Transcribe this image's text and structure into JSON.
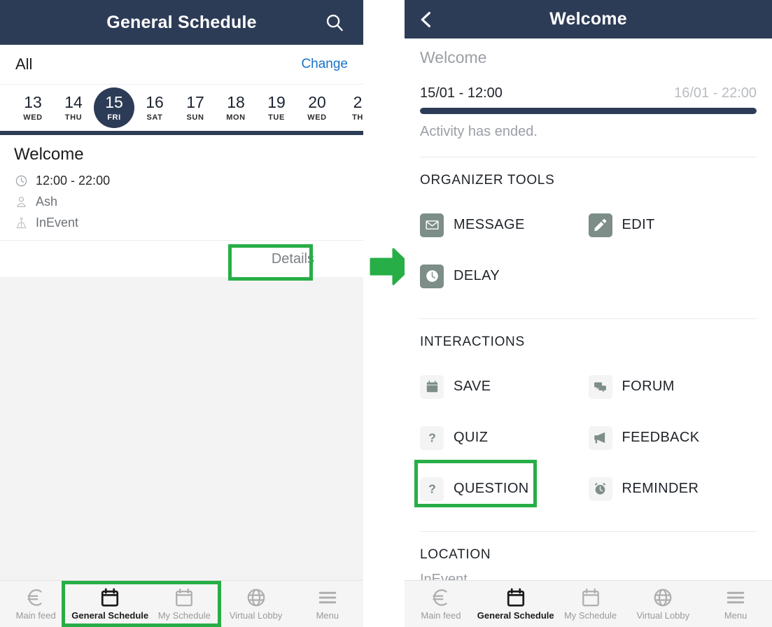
{
  "left": {
    "header": {
      "title": "General Schedule",
      "search_icon": "search-icon"
    },
    "filter": {
      "label": "All",
      "change_label": "Change"
    },
    "dates": [
      {
        "day": "13",
        "dow": "WED",
        "selected": false
      },
      {
        "day": "14",
        "dow": "THU",
        "selected": false
      },
      {
        "day": "15",
        "dow": "FRI",
        "selected": true
      },
      {
        "day": "16",
        "dow": "SAT",
        "selected": false
      },
      {
        "day": "17",
        "dow": "SUN",
        "selected": false
      },
      {
        "day": "18",
        "dow": "MON",
        "selected": false
      },
      {
        "day": "19",
        "dow": "TUE",
        "selected": false
      },
      {
        "day": "20",
        "dow": "WED",
        "selected": false
      },
      {
        "day": "2",
        "dow": "TH",
        "selected": false
      }
    ],
    "event": {
      "title": "Welcome",
      "time": "12:00 - 22:00",
      "speaker": "Ash",
      "location": "InEvent",
      "details_label": "Details"
    }
  },
  "right": {
    "header": {
      "title": "Welcome",
      "back_icon": "chevron-left-icon"
    },
    "subtitle": "Welcome",
    "start_time": "15/01 - 12:00",
    "end_time": "16/01 - 22:00",
    "progress_percent": 100,
    "status": "Activity has ended.",
    "organizer_tools": {
      "title": "ORGANIZER TOOLS",
      "items": [
        {
          "label": "MESSAGE",
          "icon": "envelope-icon"
        },
        {
          "label": "EDIT",
          "icon": "pencil-icon"
        },
        {
          "label": "DELAY",
          "icon": "clock-icon"
        }
      ]
    },
    "interactions": {
      "title": "INTERACTIONS",
      "items": [
        {
          "label": "SAVE",
          "icon": "calendar-save-icon"
        },
        {
          "label": "FORUM",
          "icon": "chat-bubbles-icon"
        },
        {
          "label": "QUIZ",
          "icon": "question-mark-icon"
        },
        {
          "label": "FEEDBACK",
          "icon": "megaphone-icon"
        },
        {
          "label": "QUESTION",
          "icon": "question-mark-icon"
        },
        {
          "label": "REMINDER",
          "icon": "alarm-clock-icon"
        }
      ]
    },
    "location": {
      "title": "LOCATION",
      "value": "InEvent"
    }
  },
  "bottom_nav": {
    "items": [
      {
        "label": "Main feed",
        "icon": "euro-icon",
        "active": false
      },
      {
        "label": "General Schedule",
        "icon": "calendar-icon",
        "active": true
      },
      {
        "label": "My Schedule",
        "icon": "calendar-icon",
        "active": false
      },
      {
        "label": "Virtual Lobby",
        "icon": "globe-icon",
        "active": false
      },
      {
        "label": "Menu",
        "icon": "hamburger-icon",
        "active": false
      }
    ]
  },
  "annotations": {
    "highlight_color": "#27ae46",
    "arrow_icon": "right-arrow-icon",
    "highlighted": [
      "Details",
      "General Schedule",
      "QUESTION"
    ]
  },
  "colors": {
    "header_bg": "#2d3c56",
    "accent_link": "#1a73c7",
    "highlight_green": "#27ae46",
    "tool_solid": "#7d8d88",
    "tool_light": "#f4f4f4"
  }
}
